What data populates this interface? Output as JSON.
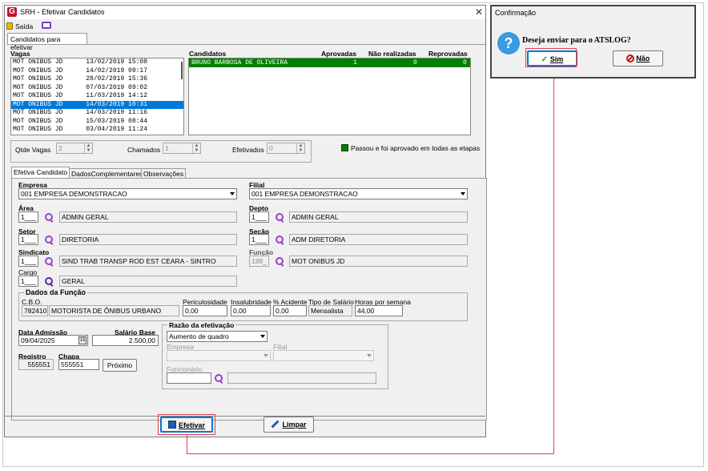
{
  "window": {
    "title": "SRH - Efetivar Candidatos",
    "logo": "G"
  },
  "toolbar": {
    "exit_label": "Saída"
  },
  "main_tab": "Candidatos para efetivar",
  "vagas": {
    "header": "Vagas",
    "rows": [
      "MOT ONIBUS JD      13/02/2019 15:08",
      "MOT ONIBUS JD      14/02/2019 09:17",
      "MOT ONIBUS JD      28/02/2019 15:36",
      "MOT ONIBUS JD      07/03/2019 09:02",
      "MOT ONIBUS JD      11/03/2019 14:12",
      "MOT ONIBUS JD      14/03/2019 10:31",
      "MOT ONIBUS JD      14/03/2019 11:16",
      "MOT ONIBUS JD      15/03/2019 08:44",
      "MOT ONIBUS JD      03/04/2019 11:24"
    ],
    "selected_index": 5
  },
  "candidatos": {
    "headers": {
      "name": "Candidatos",
      "aprovadas": "Aprovadas",
      "nao_realizadas": "Não realizadas",
      "reprovadas": "Reprovadas"
    },
    "rows": [
      {
        "name": "BRUNO BARBOSA DE OLIVEIRA",
        "aprovadas": "1",
        "nao_realizadas": "0",
        "reprovadas": "0"
      }
    ]
  },
  "counters": {
    "qtde_label": "Qtde Vagas",
    "qtde_value": "2",
    "chamados_label": "Chamados",
    "chamados_value": "1",
    "efetivados_label": "Efetivados",
    "efetivados_value": "0"
  },
  "legend": {
    "text": "Passou e foi aprovado em todas as etapas",
    "color": "#008000"
  },
  "subtabs": [
    "Efetiva Candidato",
    "DadosComplementares",
    "Observações"
  ],
  "form": {
    "empresa_label": "Empresa",
    "empresa_value": "001 EMPRESA DEMONSTRACAO",
    "filial_label": "Filial",
    "filial_value": "001 EMPRESA DEMONSTRACAO",
    "area_label": "Área",
    "area_code": "1___",
    "area_name": "ADMIN GERAL",
    "depto_label": "Depto",
    "depto_code": "1___",
    "depto_name": "ADMIN GERAL",
    "setor_label": "Setor",
    "setor_code": "1___",
    "setor_name": "DIRETORIA",
    "secao_label": "Seção",
    "secao_code": "1___",
    "secao_name": "ADM DIRETORIA",
    "sindicato_label": "Sindicato",
    "sindicato_code": "1___",
    "sindicato_name": "SIND TRAB TRANSP ROD EST CEARA - SINTRO",
    "funcao_label": "Função",
    "funcao_code": "188_",
    "funcao_name": "MOT ONIBUS JD",
    "cargo_label": "Cargo",
    "cargo_code": "1___",
    "cargo_name": "GERAL"
  },
  "dados_funcao": {
    "title": "Dados da Função",
    "cbo_label": "C.B.O.",
    "cbo_code": "782410",
    "cbo_name": "MOTORISTA DE ÔNIBUS URBANO",
    "peric_label": "Periculosidade",
    "peric_value": "0,00",
    "insal_label": "Insalubridade",
    "insal_value": "0,00",
    "acid_label": "% Acidente",
    "acid_value": "0,00",
    "tipo_label": "Tipo de Salário",
    "tipo_value": "Mensalista",
    "horas_label": "Horas por semana",
    "horas_value": "44,00"
  },
  "admissao": {
    "data_label": "Data Admissão",
    "data_value": "09/04/2025",
    "salario_label": "Salário Base",
    "salario_value": "2.500,00",
    "registro_label": "Registro",
    "registro_value": "555551",
    "chapa_label": "Chapa",
    "chapa_value": "555551",
    "proximo_label": "Próximo"
  },
  "razao": {
    "title": "Razão da efetivação",
    "value": "Aumento de quadro",
    "empresa_label": "Empresa",
    "filial_label": "Filial",
    "funcionario_label": "Funcionário"
  },
  "buttons": {
    "efetivar": "Efetivar",
    "limpar": "Limpar"
  },
  "dialog": {
    "title": "Confirmação",
    "message": "Deseja enviar para o ATSLOG?",
    "yes": "Sim",
    "no": "Não"
  }
}
